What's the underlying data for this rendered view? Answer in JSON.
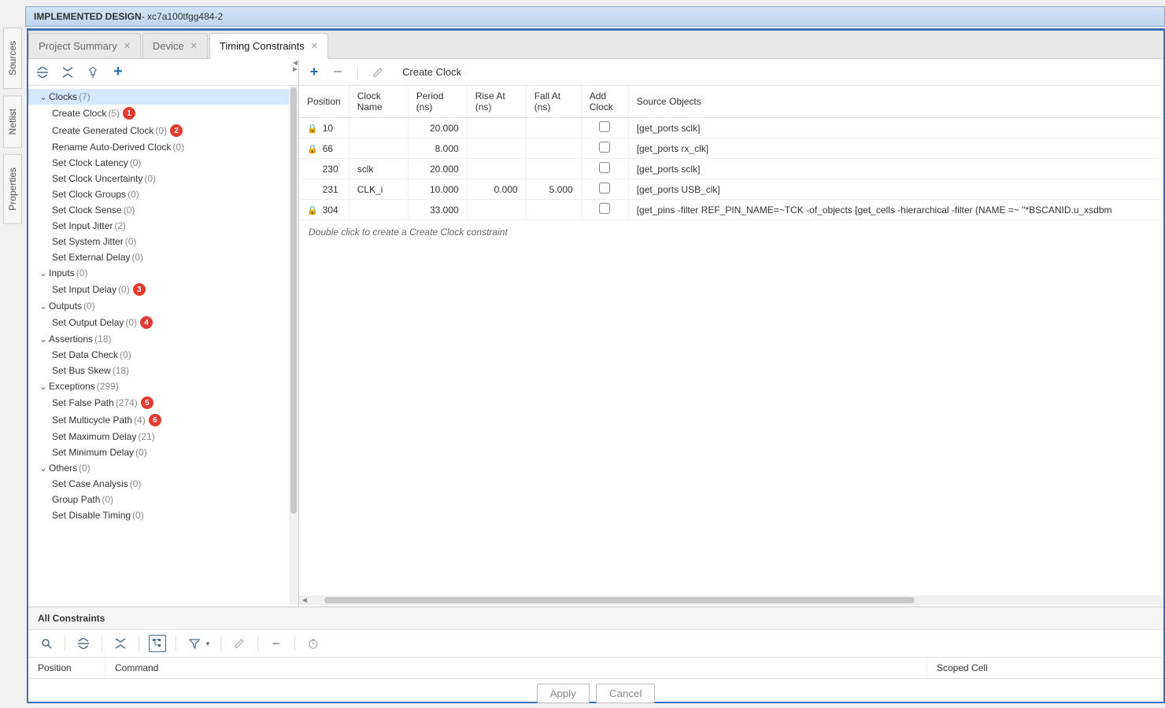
{
  "title": {
    "bold": "IMPLEMENTED DESIGN",
    "rest": " - xc7a100tfgg484-2"
  },
  "sideTabs": [
    "Sources",
    "Netlist",
    "Properties"
  ],
  "tabs": [
    {
      "label": "Project Summary",
      "active": false
    },
    {
      "label": "Device",
      "active": false
    },
    {
      "label": "Timing Constraints",
      "active": true
    }
  ],
  "tree": [
    {
      "label": "Clocks",
      "count": "(7)",
      "expanded": true,
      "selected": true,
      "children": [
        {
          "label": "Create Clock",
          "count": "(5)",
          "badge": "1"
        },
        {
          "label": "Create Generated Clock",
          "count": "(0)",
          "badge": "2"
        },
        {
          "label": "Rename Auto-Derived Clock",
          "count": "(0)"
        },
        {
          "label": "Set Clock Latency",
          "count": "(0)"
        },
        {
          "label": "Set Clock Uncertainty",
          "count": "(0)"
        },
        {
          "label": "Set Clock Groups",
          "count": "(0)"
        },
        {
          "label": "Set Clock Sense",
          "count": "(0)"
        },
        {
          "label": "Set Input Jitter",
          "count": "(2)"
        },
        {
          "label": "Set System Jitter",
          "count": "(0)"
        },
        {
          "label": "Set External Delay",
          "count": "(0)"
        }
      ]
    },
    {
      "label": "Inputs",
      "count": "(0)",
      "expanded": true,
      "children": [
        {
          "label": "Set Input Delay",
          "count": "(0)",
          "badge": "3"
        }
      ]
    },
    {
      "label": "Outputs",
      "count": "(0)",
      "expanded": true,
      "children": [
        {
          "label": "Set Output Delay",
          "count": "(0)",
          "badge": "4"
        }
      ]
    },
    {
      "label": "Assertions",
      "count": "(18)",
      "expanded": true,
      "children": [
        {
          "label": "Set Data Check",
          "count": "(0)"
        },
        {
          "label": "Set Bus Skew",
          "count": "(18)"
        }
      ]
    },
    {
      "label": "Exceptions",
      "count": "(299)",
      "expanded": true,
      "children": [
        {
          "label": "Set False Path",
          "count": "(274)",
          "badge": "5"
        },
        {
          "label": "Set Multicycle Path",
          "count": "(4)",
          "badge": "6"
        },
        {
          "label": "Set Maximum Delay",
          "count": "(21)"
        },
        {
          "label": "Set Minimum Delay",
          "count": "(0)"
        }
      ]
    },
    {
      "label": "Others",
      "count": "(0)",
      "expanded": true,
      "children": [
        {
          "label": "Set Case Analysis",
          "count": "(0)"
        },
        {
          "label": "Group Path",
          "count": "(0)"
        },
        {
          "label": "Set Disable Timing",
          "count": "(0)"
        }
      ]
    }
  ],
  "tableTitle": "Create Clock",
  "columns": [
    "Position",
    "Clock Name",
    "Period (ns)",
    "Rise At (ns)",
    "Fall At (ns)",
    "Add Clock",
    "Source Objects"
  ],
  "rows": [
    {
      "locked": true,
      "pos": "10",
      "name": "",
      "period": "20.000",
      "rise": "",
      "fall": "",
      "src": "[get_ports sclk]"
    },
    {
      "locked": true,
      "pos": "66",
      "name": "",
      "period": "8.000",
      "rise": "",
      "fall": "",
      "src": "[get_ports rx_clk]"
    },
    {
      "locked": false,
      "pos": "230",
      "name": "sclk",
      "period": "20.000",
      "rise": "",
      "fall": "",
      "src": "[get_ports sclk]"
    },
    {
      "locked": false,
      "pos": "231",
      "name": "CLK_i",
      "period": "10.000",
      "rise": "0.000",
      "fall": "5.000",
      "src": "[get_ports USB_clk]"
    },
    {
      "locked": true,
      "pos": "304",
      "name": "",
      "period": "33.000",
      "rise": "",
      "fall": "",
      "src": "[get_pins -filter REF_PIN_NAME=~TCK -of_objects [get_cells -hierarchical -filter {NAME =~ \"*BSCANID.u_xsdbm"
    }
  ],
  "hint": "Double click to create a Create Clock constraint",
  "bottom": {
    "title": "All Constraints",
    "cols": [
      "Position",
      "Command",
      "Scoped Cell"
    ],
    "apply": "Apply",
    "cancel": "Cancel"
  }
}
